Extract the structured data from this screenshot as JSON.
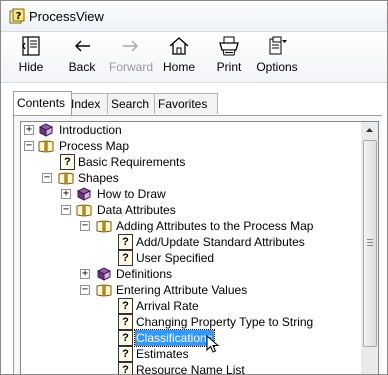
{
  "window": {
    "title": "ProcessView"
  },
  "toolbar": {
    "hide": "Hide",
    "back": "Back",
    "forward": "Forward",
    "home": "Home",
    "print": "Print",
    "options": "Options"
  },
  "tabs": {
    "contents": "Contents",
    "index": "Index",
    "search": "Search",
    "favorites": "Favorites"
  },
  "tree": {
    "introduction": "Introduction",
    "process_map": "Process Map",
    "basic_requirements": "Basic Requirements",
    "shapes": "Shapes",
    "how_to_draw": "How to Draw",
    "data_attributes": "Data Attributes",
    "adding_attributes": "Adding Attributes to the Process Map",
    "add_update_standard": "Add/Update Standard Attributes",
    "user_specified": "User Specified",
    "definitions": "Definitions",
    "entering_attribute_values": "Entering Attribute Values",
    "arrival_rate": "Arrival Rate",
    "changing_property_type": "Changing Property Type to String",
    "classifications": "Classifications",
    "estimates": "Estimates",
    "resource_name_list": "Resource Name List"
  }
}
